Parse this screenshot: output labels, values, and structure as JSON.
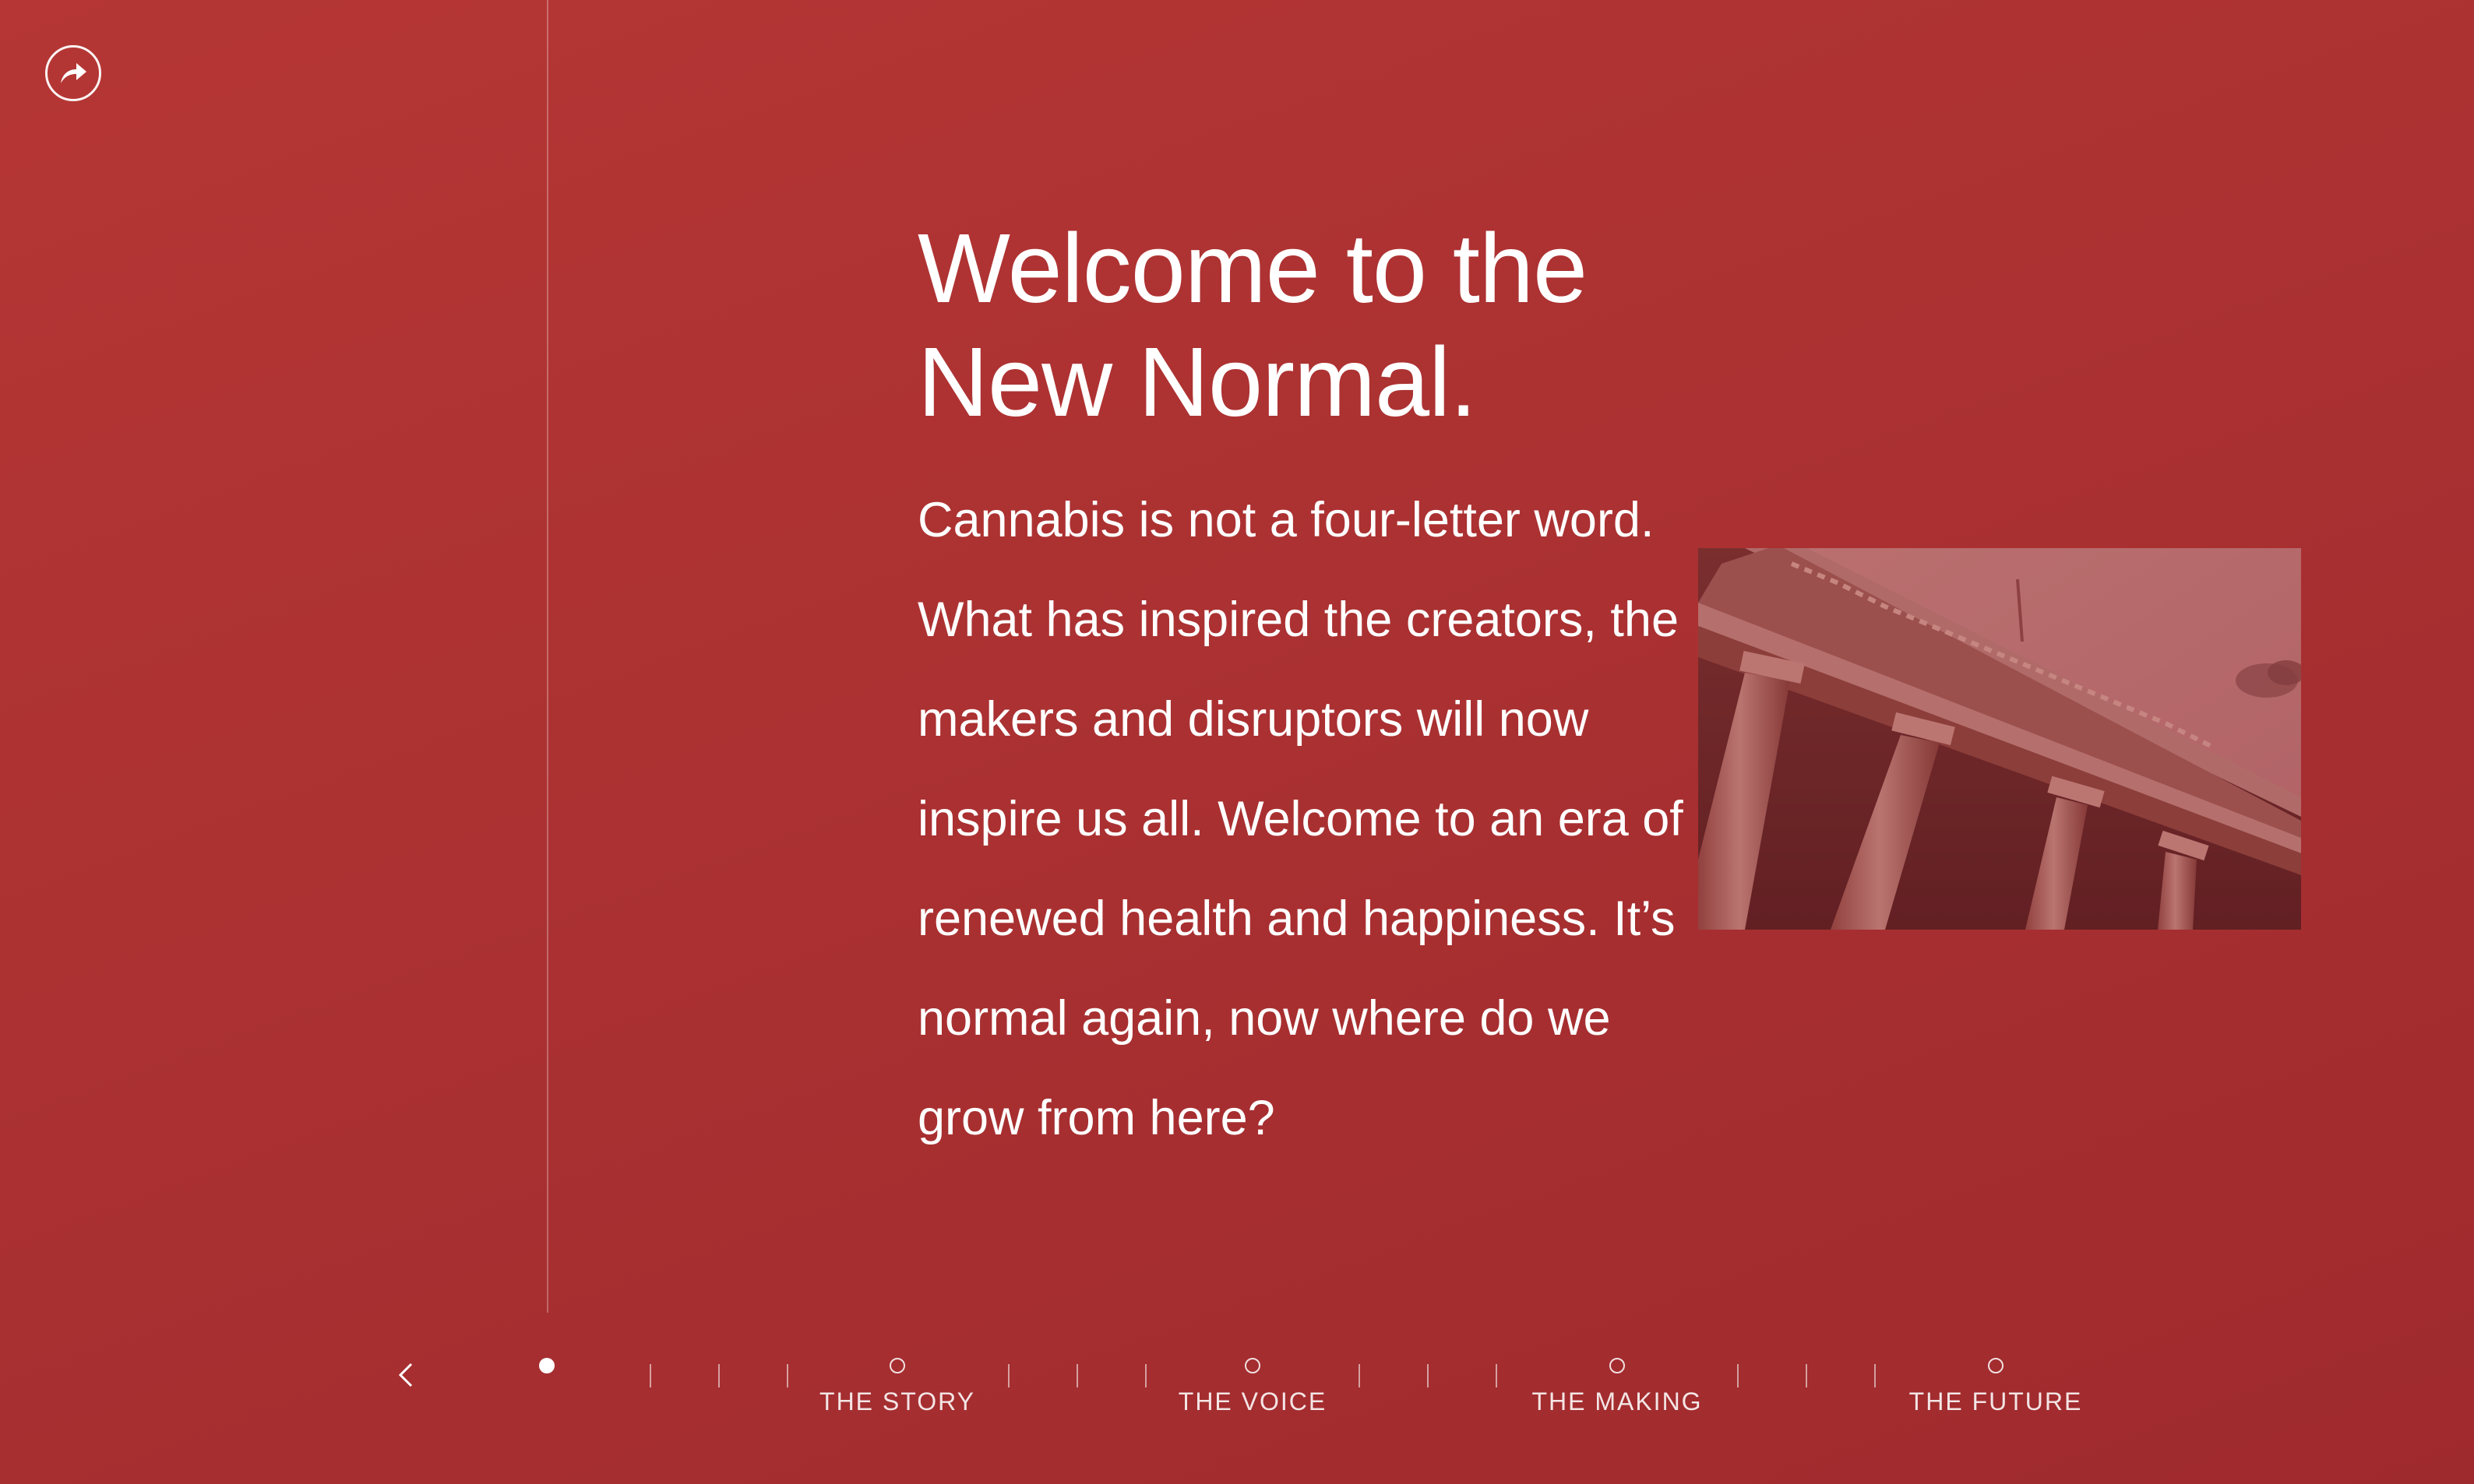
{
  "header": {
    "share_icon": "share-arrow-icon"
  },
  "content": {
    "headline": "Welcome to the\nNew Normal.",
    "body": "Cannabis is not a four-letter word. What has inspired the creators, the makers and disruptors will now inspire us all. Welcome to an era of renewed health and happiness. It’s normal again, now where do we grow from here?",
    "image": "courthouse-columns-image"
  },
  "nav": {
    "prev_icon": "chevron-left-icon",
    "sections": [
      {
        "label": "THE STORY"
      },
      {
        "label": "THE VOICE"
      },
      {
        "label": "THE MAKING"
      },
      {
        "label": "THE FUTURE"
      }
    ]
  },
  "colors": {
    "background": "#ab3132",
    "text": "#ffffff"
  }
}
